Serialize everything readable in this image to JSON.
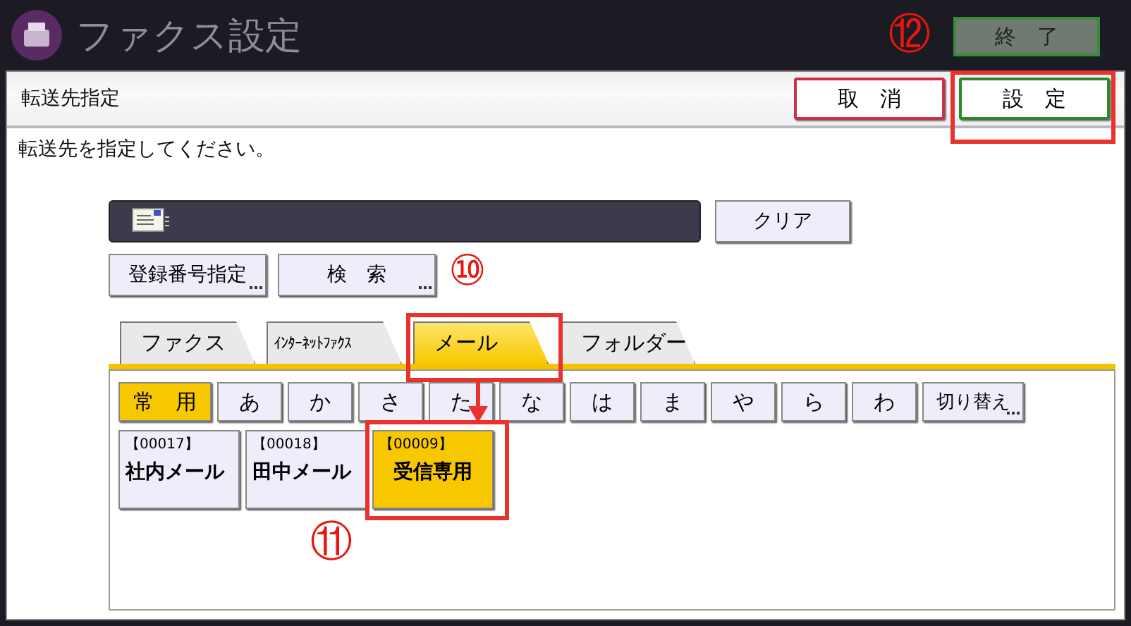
{
  "title_bar": {
    "title": "ファクス設定",
    "end_button": "終　了"
  },
  "header": {
    "title": "転送先指定",
    "buttons": [
      {
        "label": "取　消",
        "kind": "cancel"
      },
      {
        "label": "設　定",
        "kind": "ok"
      }
    ]
  },
  "message": "転送先を指定してください。",
  "destination_field": {
    "clear_button": "クリア"
  },
  "search_buttons": [
    {
      "label": "登録番号指定"
    },
    {
      "label": "検　索"
    }
  ],
  "tabs": [
    {
      "label": "ファクス",
      "kind": "normal",
      "selected": false
    },
    {
      "label": "ｲﾝﾀｰﾈｯﾄﾌｧｸｽ",
      "kind": "narrow",
      "selected": false
    },
    {
      "label": "メール",
      "kind": "normal",
      "selected": true
    },
    {
      "label": "フォルダー",
      "kind": "normal",
      "selected": false
    }
  ],
  "index_keys": [
    {
      "label": "常　用",
      "kind": "wide",
      "selected": true
    },
    {
      "label": "あ",
      "kind": "kana",
      "selected": false
    },
    {
      "label": "か",
      "kind": "kana",
      "selected": false
    },
    {
      "label": "さ",
      "kind": "kana",
      "selected": false
    },
    {
      "label": "た",
      "kind": "kana",
      "selected": false
    },
    {
      "label": "な",
      "kind": "kana",
      "selected": false
    },
    {
      "label": "は",
      "kind": "kana",
      "selected": false
    },
    {
      "label": "ま",
      "kind": "kana",
      "selected": false
    },
    {
      "label": "や",
      "kind": "kana",
      "selected": false
    },
    {
      "label": "ら",
      "kind": "kana",
      "selected": false
    },
    {
      "label": "わ",
      "kind": "kana",
      "selected": false
    },
    {
      "label": "切り替え",
      "kind": "switch",
      "selected": false
    }
  ],
  "entries": [
    {
      "number": "【00017】",
      "name": "社内メール",
      "selected": false
    },
    {
      "number": "【00018】",
      "name": "田中メール",
      "selected": false
    },
    {
      "number": "【00009】",
      "name": "受信専用",
      "selected": true
    }
  ],
  "annotations": [
    "⑩",
    "⑪",
    "⑫"
  ]
}
